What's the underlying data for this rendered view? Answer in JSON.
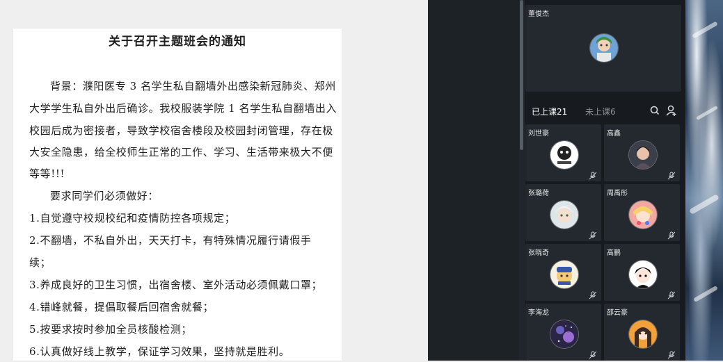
{
  "document": {
    "title": "关于召开主题班会的通知",
    "lines": [
      "背景：濮阳医专 3 名学生私自翻墙外出感染新冠肺炎、郑州",
      "大学学生私自外出后确诊。我校服装学院 1 名学生私自翻墙出入",
      "校园后成为密接者，导致学校宿舍楼段及校园封闭管理，存在极",
      "大安全隐患，给全校师生正常的工作、学习、生活带来极大不便",
      "等等!!!",
      "要求同学们必须做好：",
      "1.自觉遵守校规校纪和疫情防控各项规定；",
      "2.不翻墙，不私自外出，天天打卡，有特殊情况履行请假手",
      "续；",
      "3.养成良好的卫生习惯，出宿舍楼、室外活动必须佩戴口罩；",
      "4.错峰就餐，提倡取餐后回宿舍就餐；",
      "5.按要求按时参加全员核酸检测；",
      "6.认真做好线上教学，保证学习效果，坚持就是胜利。"
    ]
  },
  "teacher": {
    "name": "董俊杰"
  },
  "tabs": {
    "joined": "已上课21",
    "not_joined": "未上课6"
  },
  "icons": {
    "search": "search-icon",
    "add_user": "add-user-icon",
    "mic_muted": "mic-muted-icon"
  },
  "students": [
    {
      "name": "刘世豪"
    },
    {
      "name": "高鑫"
    },
    {
      "name": "张璐荷"
    },
    {
      "name": "周禹彤"
    },
    {
      "name": "张晓奇"
    },
    {
      "name": "高鹏"
    },
    {
      "name": "李海龙"
    },
    {
      "name": "邵云豪"
    }
  ],
  "colors": {
    "panel_bg": "#171b1f",
    "card_bg": "#23292f",
    "active_tab": "#ffffff",
    "inactive_tab": "#8b9197"
  }
}
